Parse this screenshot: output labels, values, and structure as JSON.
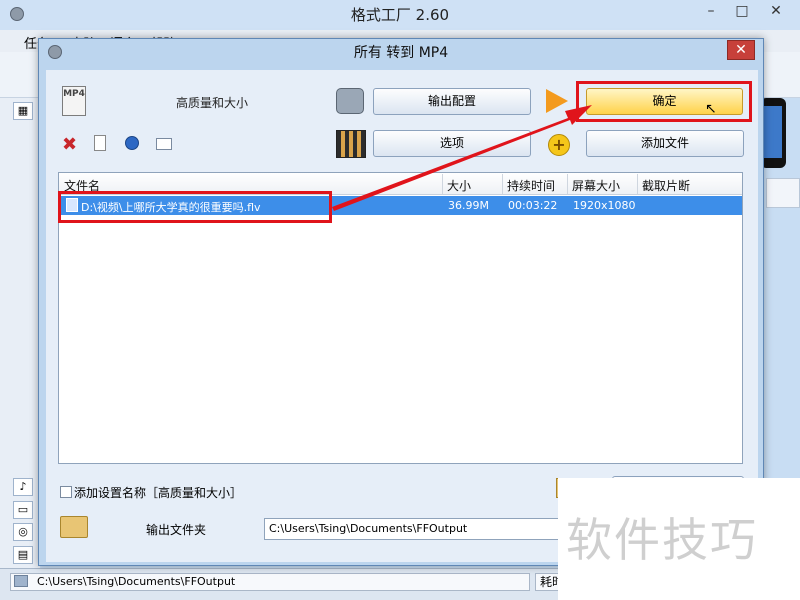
{
  "app": {
    "title": "格式工厂 2.60",
    "menu": [
      "任务",
      "皮肤",
      "语言",
      "帮助"
    ],
    "window_controls": [
      "–",
      "□",
      "✕"
    ],
    "status_path": "C:\\Users\\Tsing\\Documents\\FFOutput",
    "status_time_label": "耗时"
  },
  "dialog": {
    "title": "所有 转到 MP4",
    "close": "✕",
    "format_icon_text": "MP4",
    "quality_label": "高质量和大小",
    "output_config_button": "输出配置",
    "confirm_button": "确定",
    "options_button": "选项",
    "add_file_button": "添加文件",
    "add_file_icon": "+",
    "delete_icon": "✖",
    "table": {
      "columns": [
        "文件名",
        "大小",
        "持续时间",
        "屏幕大小",
        "截取片断"
      ],
      "rows": [
        {
          "filename": "D:\\视频\\上哪所大学真的很重要吗.flv",
          "size": "36.99M",
          "duration": "00:03:22",
          "resolution": "1920x1080",
          "clip": ""
        }
      ]
    },
    "add_setting_name_label": "添加设置名称［高质量和大小］",
    "add_setting_name_checked": false,
    "output_folder_label": "输出文件夹",
    "output_folder_path": "C:\\Users\\Tsing\\Documents\\FFOutput"
  },
  "watermark": "软件技巧",
  "colors": {
    "highlight_box": "#e0141b",
    "selection": "#3d8ee9",
    "confirm_button": "#ffd24a"
  }
}
